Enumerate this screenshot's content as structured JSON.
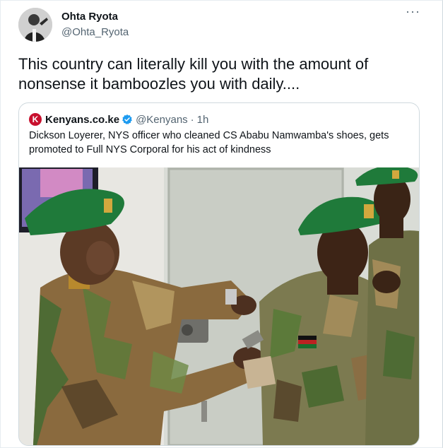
{
  "tweet": {
    "author": {
      "name": "Ohta Ryota",
      "handle": "@Ohta_Ryota"
    },
    "text": "This country can literally kill you with the amount of nonsense it bamboozles you with daily....",
    "more_icon": "more-dots-icon"
  },
  "quoted_tweet": {
    "author": {
      "name": "Kenyans.co.ke",
      "handle": "@Kenyans",
      "separator": "·",
      "time": "1h",
      "logo_letter": "K"
    },
    "text": "Dickson Loyerer, NYS officer who cleaned CS Ababu Namwamba's shoes, gets promoted to Full NYS Corporal for his act of kindness",
    "media": "photo-nys-promotion-ceremony"
  },
  "colors": {
    "accent": "#1d9bf0",
    "text": "#0f1419",
    "secondary": "#536471",
    "border": "#cfd9de",
    "kenyans_brand": "#c8102e",
    "beret": "#1f7a3a"
  }
}
